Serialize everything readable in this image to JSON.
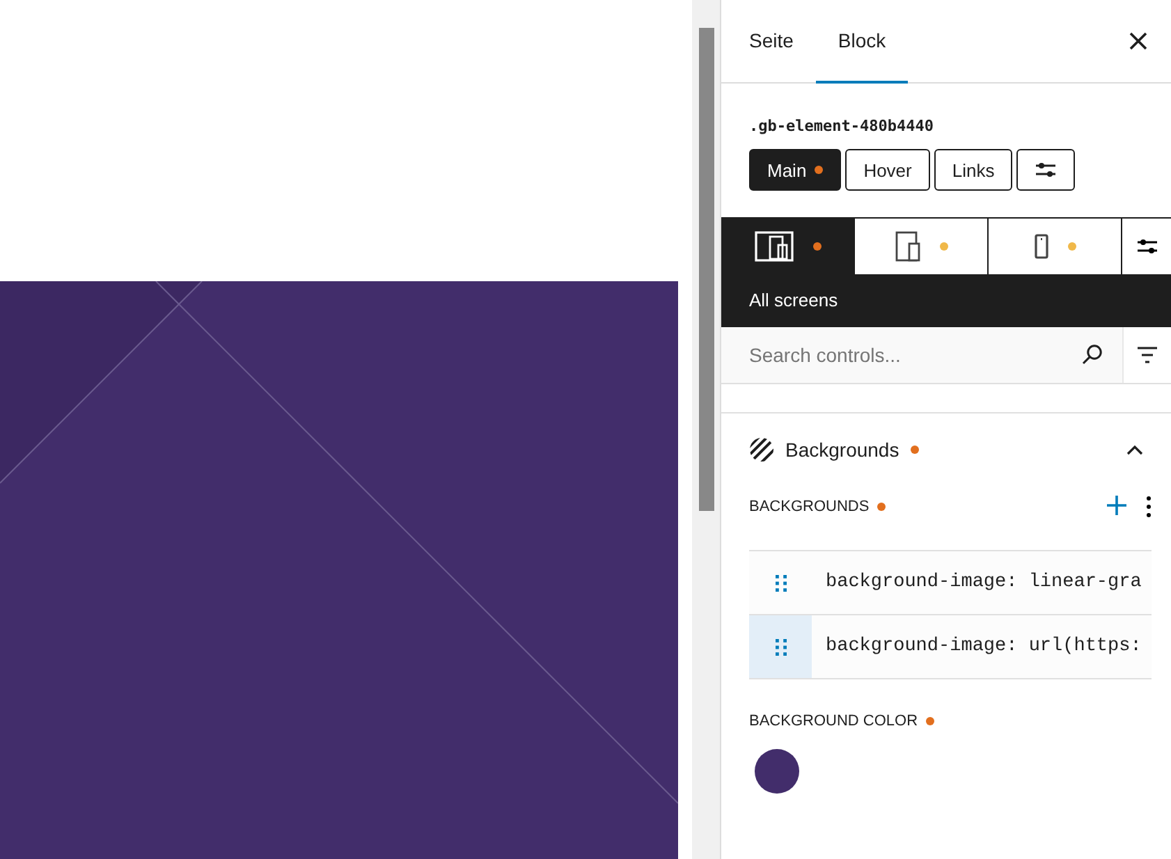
{
  "sidebar": {
    "tabs": [
      {
        "label": "Seite",
        "selected": false
      },
      {
        "label": "Block",
        "selected": true
      }
    ],
    "selector": ".gb-element-480b4440",
    "states": [
      {
        "label": "Main",
        "selected": true,
        "modified": true
      },
      {
        "label": "Hover",
        "selected": false,
        "modified": false
      },
      {
        "label": "Links",
        "selected": false,
        "modified": false
      }
    ],
    "devices": [
      {
        "kind": "desktop",
        "selected": true,
        "color": "#e26f1e"
      },
      {
        "kind": "tablet",
        "selected": false,
        "color": "#f0b849"
      },
      {
        "kind": "mobile",
        "selected": false,
        "color": "#f0b849"
      }
    ],
    "device_label": "All screens",
    "search": {
      "placeholder": "Search controls..."
    },
    "panel": {
      "title": "Backgrounds",
      "modified": true,
      "expanded": true,
      "backgrounds_label": "BACKGROUNDS",
      "layers": [
        {
          "text": "background-image: linear-gra",
          "hovered": false
        },
        {
          "text": "background-image: url(https:",
          "hovered": true
        }
      ],
      "color_label": "BACKGROUND COLOR",
      "color": "#422d6b"
    }
  }
}
